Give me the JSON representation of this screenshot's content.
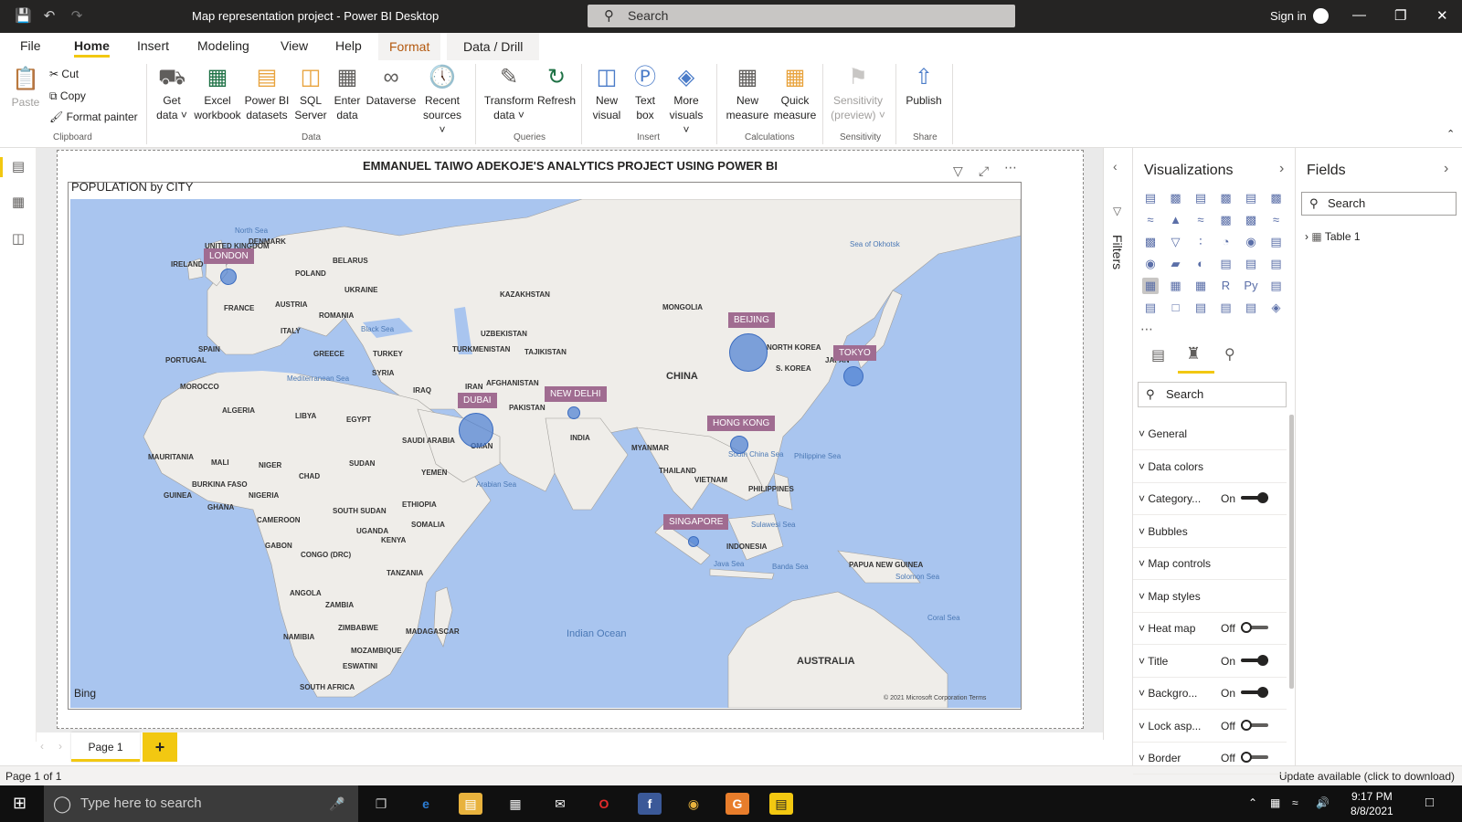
{
  "titlebar": {
    "title": "Map representation project - Power BI Desktop",
    "search": "Search",
    "signin": "Sign in"
  },
  "tabs": [
    "File",
    "Home",
    "Insert",
    "Modeling",
    "View",
    "Help",
    "Format",
    "Data / Drill"
  ],
  "ribbon": {
    "clipboard": {
      "paste": "Paste",
      "cut": "Cut",
      "copy": "Copy",
      "format_painter": "Format painter",
      "label": "Clipboard"
    },
    "data": {
      "get_data": "Get",
      "get_data2": "data",
      "excel": "Excel",
      "excel2": "workbook",
      "pbi": "Power BI",
      "pbi2": "datasets",
      "sql": "SQL",
      "sql2": "Server",
      "enter": "Enter",
      "enter2": "data",
      "dataverse": "Dataverse",
      "recent": "Recent",
      "recent2": "sources",
      "label": "Data"
    },
    "queries": {
      "transform": "Transform",
      "transform2": "data",
      "refresh": "Refresh",
      "label": "Queries"
    },
    "insert": {
      "new_visual": "New",
      "new_visual2": "visual",
      "text_box": "Text",
      "text_box2": "box",
      "more": "More",
      "more2": "visuals",
      "label": "Insert"
    },
    "calculations": {
      "new_measure": "New",
      "new_measure2": "measure",
      "quick": "Quick",
      "quick2": "measure",
      "label": "Calculations"
    },
    "sensitivity": {
      "btn": "Sensitivity",
      "btn2": "(preview)",
      "label": "Sensitivity"
    },
    "share": {
      "publish": "Publish",
      "label": "Share"
    }
  },
  "report": {
    "title": "EMMANUEL TAIWO ADEKOJE'S ANALYTICS PROJECT USING POWER BI",
    "visual_title": "POPULATION by CITY",
    "bing": "Bing",
    "copyright": "© 2021 Microsoft Corporation  Terms",
    "cities": [
      {
        "name": "LONDON"
      },
      {
        "name": "DUBAI"
      },
      {
        "name": "NEW DELHI"
      },
      {
        "name": "BEIJING"
      },
      {
        "name": "TOKYO"
      },
      {
        "name": "HONG KONG"
      },
      {
        "name": "SINGAPORE"
      }
    ],
    "map_labels": [
      "UNITED KINGDOM",
      "IRELAND",
      "DENMARK",
      "North Sea",
      "POLAND",
      "BELARUS",
      "UKRAINE",
      "FRANCE",
      "AUSTRIA",
      "ROMANIA",
      "ITALY",
      "Black Sea",
      "SPAIN",
      "PORTUGAL",
      "GREECE",
      "TURKEY",
      "KAZAKHSTAN",
      "UZBEKISTAN",
      "TURKMENISTAN",
      "TAJIKISTAN",
      "MONGOLIA",
      "NORTH KOREA",
      "S. KOREA",
      "JAPAN",
      "CHINA",
      "Sea of Okhotsk",
      "Mediterranean Sea",
      "SYRIA",
      "IRAQ",
      "IRAN",
      "AFGHANISTAN",
      "PAKISTAN",
      "MOROCCO",
      "ALGERIA",
      "LIBYA",
      "EGYPT",
      "INDIA",
      "MYANMAR",
      "SAUDI ARABIA",
      "OMAN",
      "YEMEN",
      "Arabian Sea",
      "THAILAND",
      "VIETNAM",
      "PHILIPPINES",
      "Philippine Sea",
      "South China Sea",
      "MAURITANIA",
      "MALI",
      "NIGER",
      "CHAD",
      "SUDAN",
      "BURKINA FASO",
      "GUINEA",
      "GHANA",
      "NIGERIA",
      "CAMEROON",
      "SOUTH SUDAN",
      "ETHIOPIA",
      "SOMALIA",
      "UGANDA",
      "KENYA",
      "GABON",
      "CONGO (DRC)",
      "TANZANIA",
      "ANGOLA",
      "ZAMBIA",
      "ZIMBABWE",
      "NAMIBIA",
      "MOZAMBIQUE",
      "MADAGASCAR",
      "ESWATINI",
      "SOUTH AFRICA",
      "INDONESIA",
      "Java Sea",
      "Banda Sea",
      "Sulawesi Sea",
      "PAPUA NEW GUINEA",
      "Solomon Sea",
      "Coral Sea",
      "AUSTRALIA",
      "Indian Ocean"
    ]
  },
  "pages": {
    "page1": "Page 1",
    "status": "Page 1 of 1",
    "update": "Update available (click to download)"
  },
  "filters": {
    "label": "Filters"
  },
  "viz": {
    "title": "Visualizations",
    "search": "Search",
    "rows": [
      {
        "label": "General",
        "val": ""
      },
      {
        "label": "Data colors",
        "val": ""
      },
      {
        "label": "Category...",
        "val": "On",
        "toggle": "on"
      },
      {
        "label": "Bubbles",
        "val": ""
      },
      {
        "label": "Map controls",
        "val": ""
      },
      {
        "label": "Map styles",
        "val": ""
      },
      {
        "label": "Heat map",
        "val": "Off",
        "toggle": "off"
      },
      {
        "label": "Title",
        "val": "On",
        "toggle": "on"
      },
      {
        "label": "Backgro...",
        "val": "On",
        "toggle": "on"
      },
      {
        "label": "Lock asp...",
        "val": "Off",
        "toggle": "off"
      },
      {
        "label": "Border",
        "val": "Off",
        "toggle": "off"
      }
    ]
  },
  "fields": {
    "title": "Fields",
    "search": "Search",
    "table": "Table 1"
  },
  "taskbar": {
    "search": "Type here to search",
    "time": "9:17 PM",
    "date": "8/8/2021"
  }
}
